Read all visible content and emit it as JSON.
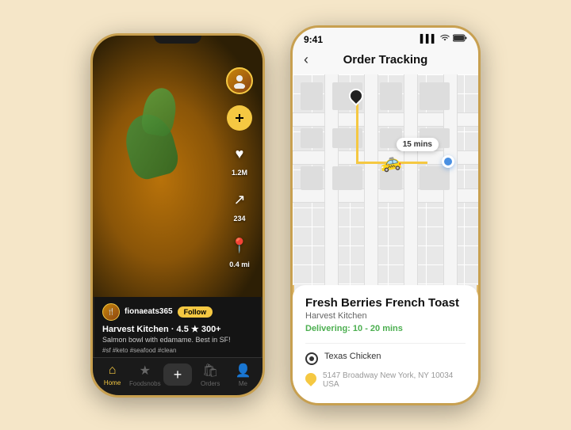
{
  "left_phone": {
    "user": {
      "username": "fionaeats365",
      "follow_label": "Follow"
    },
    "restaurant": {
      "name": "Harvest Kitchen",
      "rating": "4.5 ★",
      "reviews": "300+",
      "description": "Salmon bowl with edamame. Best in SF!",
      "hashtags": "#sf #keto #seafood #clean"
    },
    "actions": {
      "likes": "1.2M",
      "shares": "234",
      "distance": "0.4 mi"
    },
    "nav": [
      {
        "id": "home",
        "label": "Home",
        "icon": "⌂",
        "active": true
      },
      {
        "id": "foodsnobs",
        "label": "Foodsnobs",
        "icon": "★",
        "active": false
      },
      {
        "id": "add",
        "label": "+",
        "active": false
      },
      {
        "id": "orders",
        "label": "Orders",
        "icon": "🛍",
        "active": false
      },
      {
        "id": "me",
        "label": "Me",
        "icon": "👤",
        "active": false
      }
    ]
  },
  "right_phone": {
    "status_bar": {
      "time": "9:41",
      "signal": "▌▌▌",
      "wifi": "⌘",
      "battery": "▮"
    },
    "header": {
      "back_label": "‹",
      "title": "Order Tracking"
    },
    "map": {
      "eta": "15 mins"
    },
    "order": {
      "item_name": "Fresh Berries French Toast",
      "restaurant": "Harvest Kitchen",
      "status": "Delivering: 10 - 20 mins"
    },
    "locations": [
      {
        "id": "pickup",
        "name": "Texas Chicken",
        "type": "circle"
      },
      {
        "id": "delivery",
        "address": "5147 Broadway New York, NY 10034 USA",
        "type": "pin"
      }
    ]
  }
}
